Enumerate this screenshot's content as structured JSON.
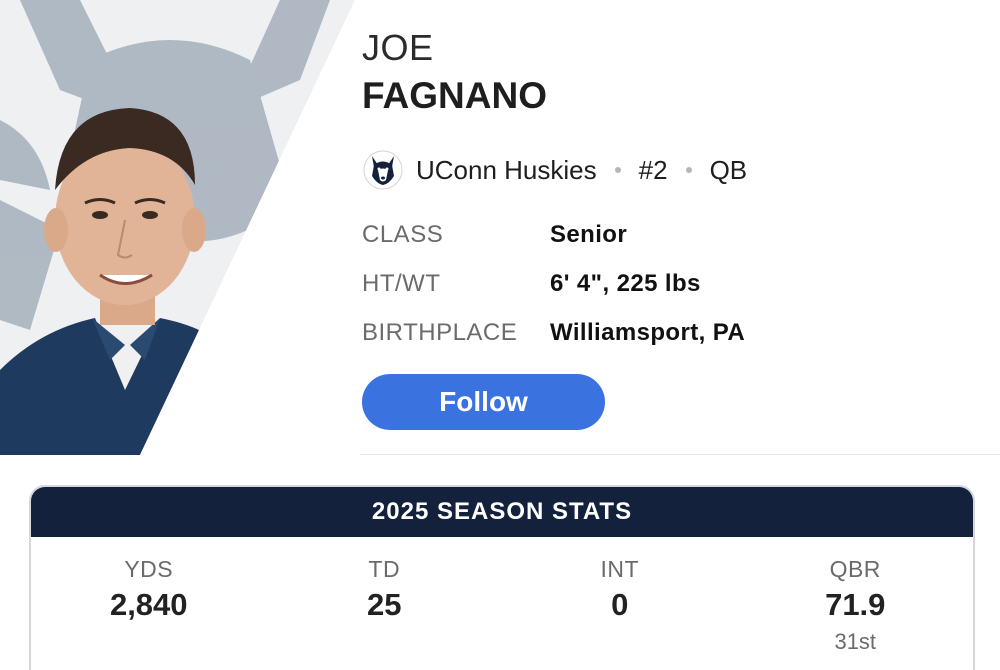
{
  "player": {
    "first_name": "JOE",
    "last_name": "FAGNANO",
    "team": "UConn Huskies",
    "number": "#2",
    "position": "QB",
    "team_logo_icon": "husky-logo-icon",
    "photo": "player-headshot"
  },
  "bio": [
    {
      "label": "CLASS",
      "value": "Senior"
    },
    {
      "label": "HT/WT",
      "value": "6' 4\", 225 lbs"
    },
    {
      "label": "BIRTHPLACE",
      "value": "Williamsport, PA"
    }
  ],
  "follow_button": {
    "label": "Follow"
  },
  "season_stats": {
    "title": "2025 SEASON STATS",
    "stats": [
      {
        "label": "YDS",
        "value": "2,840",
        "rank": ""
      },
      {
        "label": "TD",
        "value": "25",
        "rank": ""
      },
      {
        "label": "INT",
        "value": "0",
        "rank": ""
      },
      {
        "label": "QBR",
        "value": "71.9",
        "rank": "31st"
      }
    ]
  },
  "colors": {
    "accent_blue": "#3a73e0",
    "navy": "#14213d",
    "watermark_gray": "#9aa6b2"
  }
}
